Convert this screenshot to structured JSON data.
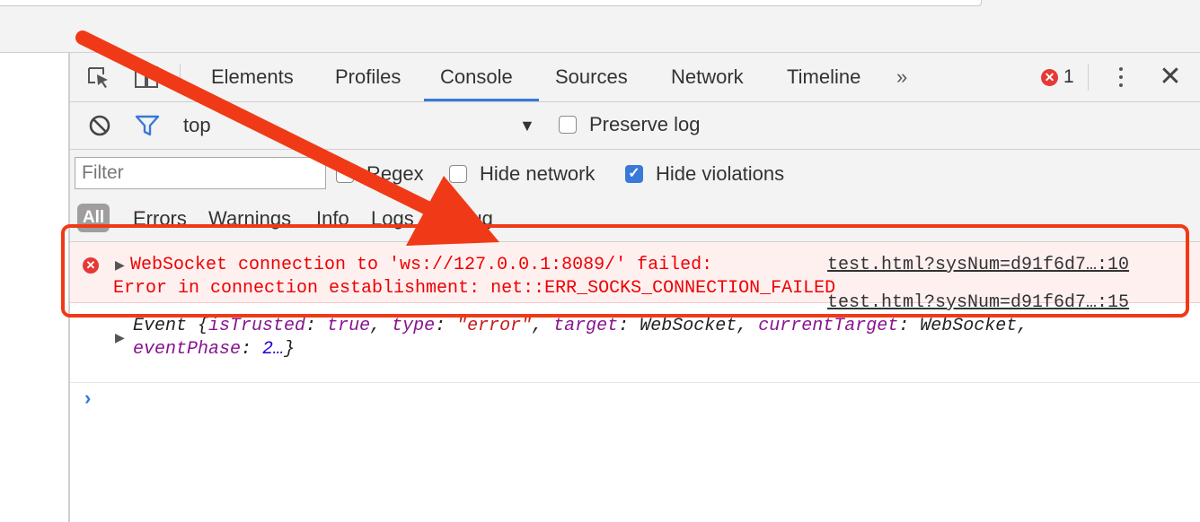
{
  "devtools": {
    "tabs": [
      "Elements",
      "Profiles",
      "Console",
      "Sources",
      "Network",
      "Timeline"
    ],
    "more_tabs": "»",
    "error_count": "1",
    "active_tab": "Console"
  },
  "console_toolbar": {
    "context": "top",
    "preserve_log_label": "Preserve log",
    "preserve_log_checked": false
  },
  "filter_bar": {
    "placeholder": "Filter",
    "regex_label": "Regex",
    "hide_network_label": "Hide network",
    "hide_violations_label": "Hide violations",
    "hide_violations_checked": true
  },
  "levels": [
    "All",
    "Errors",
    "Warnings",
    "Info",
    "Logs",
    "Debug"
  ],
  "messages": {
    "error": {
      "line1": "WebSocket connection to 'ws://127.0.0.1:8089/' failed:",
      "line2": "Error in connection establishment: net::ERR_SOCKS_CONNECTION_FAILED",
      "source": "test.html?sysNum=d91f6d7…:10"
    },
    "event": {
      "source": "test.html?sysNum=d91f6d7…:15",
      "prefix": "Event {",
      "k_isTrusted": "isTrusted",
      "v_isTrusted": "true",
      "k_type": "type",
      "v_type": "\"error\"",
      "k_target": "target",
      "v_target": "WebSocket",
      "k_currentTarget": "currentTarget",
      "v_currentTarget": "WebSocket",
      "k_eventPhase": "eventPhase",
      "v_eventPhase": "2…",
      "suffix": "}"
    }
  },
  "prompt_symbol": "›",
  "colors": {
    "annotation": "#f03a17",
    "error_text": "#e00000",
    "active_tab_underline": "#3879d9"
  }
}
